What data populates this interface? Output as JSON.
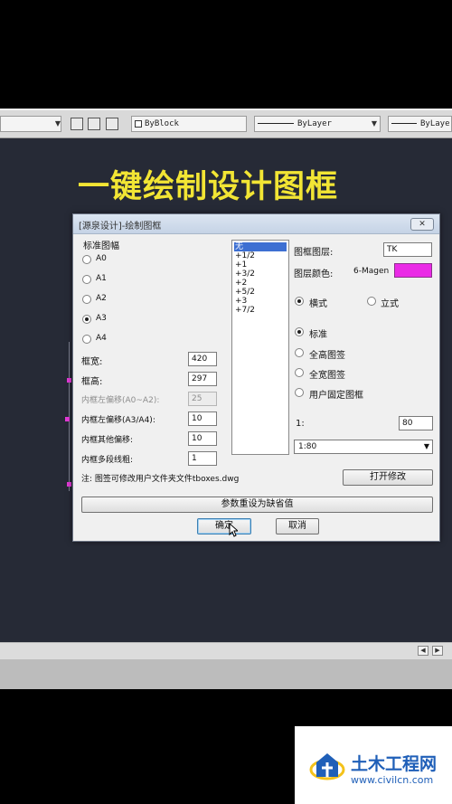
{
  "toolbar": {
    "block_label": "ByBlock",
    "linetype_label": "ByLayer",
    "lineweight_label": "ByLaye"
  },
  "canvas": {
    "headline": "一键绘制设计图框"
  },
  "dialog": {
    "title": "[源泉设计]-绘制图框",
    "close_glyph": "✕",
    "paper_group_label": "标准图幅",
    "paper_sizes": [
      {
        "label": "A0",
        "selected": false
      },
      {
        "label": "A1",
        "selected": false
      },
      {
        "label": "A2",
        "selected": false
      },
      {
        "label": "A3",
        "selected": true
      },
      {
        "label": "A4",
        "selected": false
      }
    ],
    "params": [
      {
        "label": "框宽:",
        "value": "420",
        "enabled": true
      },
      {
        "label": "框高:",
        "value": "297",
        "enabled": true
      },
      {
        "label": "内框左偏移(A0~A2):",
        "value": "25",
        "enabled": false
      },
      {
        "label": "内框左偏移(A3/A4):",
        "value": "10",
        "enabled": true
      },
      {
        "label": "内框其他偏移:",
        "value": "10",
        "enabled": true
      },
      {
        "label": "内框多段线粗:",
        "value": "1",
        "enabled": true
      }
    ],
    "list_items": [
      "无",
      "+1/2",
      "+1",
      "+3/2",
      "+2",
      "+5/2",
      "+3",
      "+7/2"
    ],
    "selected_list_index": 0,
    "layer_label": "图框图层:",
    "layer_value": "TK",
    "color_label": "图层颜色:",
    "color_value": "6-Magen",
    "color_hex": "#ea2ae6",
    "orientation": [
      {
        "label": "横式",
        "selected": true
      },
      {
        "label": "立式",
        "selected": false
      }
    ],
    "title_block": [
      {
        "label": "标准",
        "selected": true
      },
      {
        "label": "全高图签",
        "selected": false
      },
      {
        "label": "全宽图签",
        "selected": false
      },
      {
        "label": "用户固定图框",
        "selected": false
      }
    ],
    "scale_label": "1:",
    "scale_value": "80",
    "scale_select": "1:80",
    "note": "注: 图签可修改用户文件夹文件tboxes.dwg",
    "open_edit_button": "打开修改",
    "reset_button": "参数重设为缺省值",
    "ok_button": "确定",
    "cancel_button": "取消"
  },
  "watermark": {
    "title": "土木工程网",
    "url": "www.civilcn.com"
  }
}
